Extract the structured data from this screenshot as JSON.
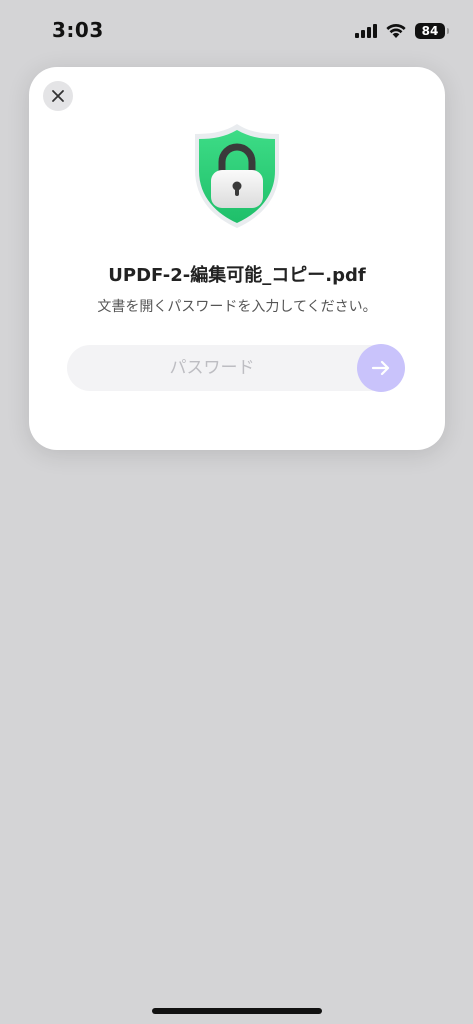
{
  "status_bar": {
    "time": "3:03",
    "battery": "84",
    "icons": [
      "signal-icon",
      "wifi-icon",
      "battery-icon"
    ]
  },
  "dialog": {
    "close_icon": "close-icon",
    "shield_icon": "shield-lock-icon",
    "file_name": "UPDF-2-編集可能_コピー.pdf",
    "message": "文書を開くパスワードを入力してください。",
    "password": {
      "value": "",
      "placeholder": "パスワード"
    },
    "submit_icon": "arrow-right-icon"
  },
  "colors": {
    "background": "#d4d4d6",
    "shield_green": "#2ecf7a",
    "submit_button": "#c9c3fb",
    "input_background": "#f3f3f5"
  }
}
